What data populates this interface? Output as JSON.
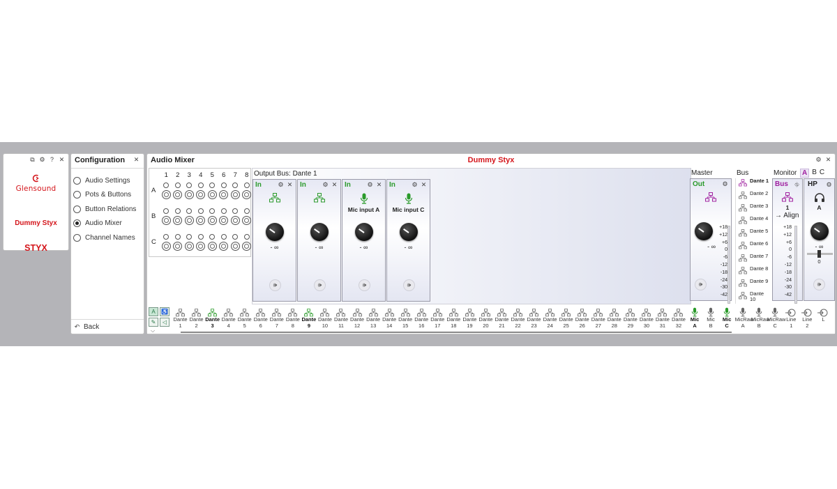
{
  "device": {
    "brand": "Glensound",
    "name": "Dummy Styx",
    "model": "STYX"
  },
  "config": {
    "title": "Configuration",
    "items": [
      {
        "label": "Audio Settings",
        "selected": false
      },
      {
        "label": "Pots & Buttons",
        "selected": false
      },
      {
        "label": "Button Relations",
        "selected": false
      },
      {
        "label": "Audio Mixer",
        "selected": true
      },
      {
        "label": "Channel Names",
        "selected": false
      }
    ],
    "back_label": "Back"
  },
  "mixer": {
    "title": "Audio Mixer",
    "device_name": "Dummy Styx",
    "matrix": {
      "columns": [
        "1",
        "2",
        "3",
        "4",
        "5",
        "6",
        "7",
        "8"
      ],
      "rows": [
        "A",
        "B",
        "C"
      ]
    },
    "output_bus_label": "Output Bus: Dante 1",
    "strips": [
      {
        "header": "In",
        "source_icon": "network-icon",
        "source_name": "",
        "value": "- ∞"
      },
      {
        "header": "In",
        "source_icon": "network-icon",
        "source_name": "",
        "value": "- ∞"
      },
      {
        "header": "In",
        "source_icon": "mic-icon",
        "source_name": "Mic input A",
        "value": "- ∞"
      },
      {
        "header": "In",
        "source_icon": "mic-icon",
        "source_name": "Mic input C",
        "value": "- ∞"
      }
    ],
    "master": {
      "label": "Master",
      "header": "Out",
      "value": "- ∞",
      "scale": [
        "+18",
        "+12",
        "+6",
        "0",
        "-6",
        "-12",
        "-18",
        "-24",
        "-30",
        "-42"
      ]
    },
    "bus": {
      "label": "Bus",
      "items": [
        "Dante 1",
        "Dante 2",
        "Dante 3",
        "Dante 4",
        "Dante 5",
        "Dante 6",
        "Dante 7",
        "Dante 8",
        "Dante 9",
        "Dante 10"
      ]
    },
    "monitor": {
      "label": "Monitor",
      "tabs": [
        "A",
        "B",
        "C"
      ],
      "active_tab": "A",
      "bus_header": "Bus",
      "bus_number": "1",
      "align_label": "→ Align",
      "scale": [
        "+18",
        "+12",
        "+6",
        "0",
        "-6",
        "-12",
        "-18",
        "-24",
        "-30",
        "-42"
      ],
      "hp_header": "HP",
      "hp_sub": "A",
      "hp_value": "- ∞",
      "hp_fader": "0"
    },
    "sources": [
      {
        "line1": "Dante",
        "line2": "1",
        "active": false,
        "icon": "network-icon"
      },
      {
        "line1": "Dante",
        "line2": "2",
        "active": false,
        "icon": "network-icon"
      },
      {
        "line1": "Dante",
        "line2": "3",
        "active": true,
        "icon": "network-icon"
      },
      {
        "line1": "Dante",
        "line2": "4",
        "active": false,
        "icon": "network-icon"
      },
      {
        "line1": "Dante",
        "line2": "5",
        "active": false,
        "icon": "network-icon"
      },
      {
        "line1": "Dante",
        "line2": "6",
        "active": false,
        "icon": "network-icon"
      },
      {
        "line1": "Dante",
        "line2": "7",
        "active": false,
        "icon": "network-icon"
      },
      {
        "line1": "Dante",
        "line2": "8",
        "active": false,
        "icon": "network-icon"
      },
      {
        "line1": "Dante",
        "line2": "9",
        "active": true,
        "icon": "network-icon"
      },
      {
        "line1": "Dante",
        "line2": "10",
        "active": false,
        "icon": "network-icon"
      },
      {
        "line1": "Dante",
        "line2": "11",
        "active": false,
        "icon": "network-icon"
      },
      {
        "line1": "Dante",
        "line2": "12",
        "active": false,
        "icon": "network-icon"
      },
      {
        "line1": "Dante",
        "line2": "13",
        "active": false,
        "icon": "network-icon"
      },
      {
        "line1": "Dante",
        "line2": "14",
        "active": false,
        "icon": "network-icon"
      },
      {
        "line1": "Dante",
        "line2": "15",
        "active": false,
        "icon": "network-icon"
      },
      {
        "line1": "Dante",
        "line2": "16",
        "active": false,
        "icon": "network-icon"
      },
      {
        "line1": "Dante",
        "line2": "17",
        "active": false,
        "icon": "network-icon"
      },
      {
        "line1": "Dante",
        "line2": "18",
        "active": false,
        "icon": "network-icon"
      },
      {
        "line1": "Dante",
        "line2": "19",
        "active": false,
        "icon": "network-icon"
      },
      {
        "line1": "Dante",
        "line2": "20",
        "active": false,
        "icon": "network-icon"
      },
      {
        "line1": "Dante",
        "line2": "21",
        "active": false,
        "icon": "network-icon"
      },
      {
        "line1": "Dante",
        "line2": "22",
        "active": false,
        "icon": "network-icon"
      },
      {
        "line1": "Dante",
        "line2": "23",
        "active": false,
        "icon": "network-icon"
      },
      {
        "line1": "Dante",
        "line2": "24",
        "active": false,
        "icon": "network-icon"
      },
      {
        "line1": "Dante",
        "line2": "25",
        "active": false,
        "icon": "network-icon"
      },
      {
        "line1": "Dante",
        "line2": "26",
        "active": false,
        "icon": "network-icon"
      },
      {
        "line1": "Dante",
        "line2": "27",
        "active": false,
        "icon": "network-icon"
      },
      {
        "line1": "Dante",
        "line2": "28",
        "active": false,
        "icon": "network-icon"
      },
      {
        "line1": "Dante",
        "line2": "29",
        "active": false,
        "icon": "network-icon"
      },
      {
        "line1": "Dante",
        "line2": "30",
        "active": false,
        "icon": "network-icon"
      },
      {
        "line1": "Dante",
        "line2": "31",
        "active": false,
        "icon": "network-icon"
      },
      {
        "line1": "Dante",
        "line2": "32",
        "active": false,
        "icon": "network-icon"
      },
      {
        "line1": "Mic",
        "line2": "A",
        "active": true,
        "icon": "mic-icon"
      },
      {
        "line1": "Mic",
        "line2": "B",
        "active": false,
        "icon": "mic-icon"
      },
      {
        "line1": "Mic",
        "line2": "C",
        "active": true,
        "icon": "mic-icon"
      },
      {
        "line1": "MicRaw",
        "line2": "A",
        "active": false,
        "icon": "mic-icon"
      },
      {
        "line1": "MicRaw",
        "line2": "B",
        "active": false,
        "icon": "mic-icon"
      },
      {
        "line1": "MicRaw",
        "line2": "C",
        "active": false,
        "icon": "mic-icon"
      },
      {
        "line1": "Line",
        "line2": "1",
        "active": false,
        "icon": "line-input-icon"
      },
      {
        "line1": "Line",
        "line2": "2",
        "active": false,
        "icon": "line-input-icon"
      },
      {
        "line1": "L",
        "line2": "",
        "active": false,
        "icon": "line-input-icon"
      }
    ]
  },
  "colors": {
    "brand_red": "#d4151b",
    "active_green": "#2a9a2a",
    "bus_purple": "#a020a0",
    "background_gray": "#b4b4b8"
  }
}
